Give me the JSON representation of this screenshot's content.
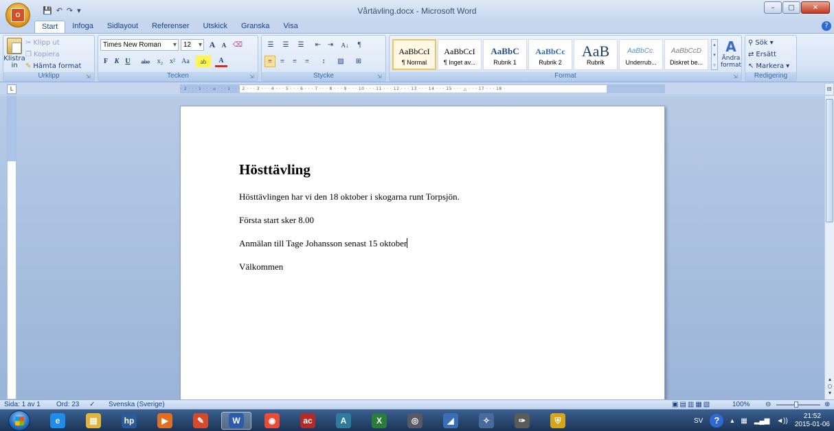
{
  "window": {
    "title": "Vårtävling.docx - Microsoft Word",
    "controls": {
      "minimize": "–",
      "maximize": "□",
      "close": "✕"
    }
  },
  "quick_access": {
    "save": "💾",
    "undo": "↶",
    "redo": "↷",
    "more": "▾"
  },
  "office_logo": "O",
  "tabs": [
    {
      "label": "Start",
      "active": true
    },
    {
      "label": "Infoga"
    },
    {
      "label": "Sidlayout"
    },
    {
      "label": "Referenser"
    },
    {
      "label": "Utskick"
    },
    {
      "label": "Granska"
    },
    {
      "label": "Visa"
    }
  ],
  "help": "?",
  "ribbon": {
    "clipboard": {
      "paste": "Klistra in",
      "cut": "Klipp ut",
      "copy": "Kopiera",
      "format_painter": "Hämta format",
      "group": "Urklipp"
    },
    "font": {
      "family": "Times New Roman",
      "size": "12",
      "grow": "A",
      "shrink": "A",
      "clear": "⌫",
      "bold": "F",
      "italic": "K",
      "underline": "U",
      "strike": "abe",
      "subscript": "x₂",
      "superscript": "x²",
      "case": "Aa",
      "highlight": "ab",
      "color": "A",
      "group": "Tecken"
    },
    "paragraph": {
      "bullets": "☰",
      "numbering": "☰",
      "multilevel": "☰",
      "decrease_indent": "⇤",
      "increase_indent": "⇥",
      "sort": "A↓",
      "pilcrow": "¶",
      "align_left": "≡",
      "center": "≡",
      "align_right": "≡",
      "justify": "≡",
      "line_spacing": "↕",
      "shading": "▨",
      "borders": "⊞",
      "group": "Stycke"
    },
    "styles": {
      "items": [
        {
          "sample": "AaBbCcI",
          "name": "¶ Normal",
          "selected": true
        },
        {
          "sample": "AaBbCcI",
          "name": "¶ Inget av..."
        },
        {
          "sample": "AaBbC",
          "name": "Rubrik 1"
        },
        {
          "sample": "AaBbCc",
          "name": "Rubrik 2"
        },
        {
          "sample": "AaB",
          "name": "Rubrik"
        },
        {
          "sample": "AaBbCc.",
          "name": "Underrub..."
        },
        {
          "sample": "AaBbCcD",
          "name": "Diskret be..."
        }
      ],
      "change_styles": "Ändra format",
      "group": "Format"
    },
    "editing": {
      "find": "Sök",
      "replace": "Ersätt",
      "select": "Markera",
      "group": "Redigering"
    }
  },
  "ruler": {
    "corner": "L",
    "text": "· 2 · · · 1 · · · ⌂ · · · 1 · · · 2 · · · 3 · · · 4 · · · 5 · · · 6 · · · 7 · · · 8 · · · 9 · · · 10 · · · 11 · · · 12 · · · 13 · · · 14 · · · 15 · · · △ · · · 17 · · · 18 ·"
  },
  "document": {
    "heading": "Hösttävling",
    "paragraphs": [
      "Hösttävlingen har vi den 18 oktober i skogarna runt Torpsjön.",
      "Första start sker 8.00",
      "Anmälan till Tage Johansson senast 15 oktober",
      "Välkommen"
    ]
  },
  "statusbar": {
    "page": "Sida: 1 av 1",
    "words": "Ord: 23",
    "language": "Svenska (Sverige)",
    "zoom": "100%"
  },
  "taskbar": {
    "apps": [
      {
        "name": "Internet Explorer",
        "icon": "e",
        "color": "#1f8ee8"
      },
      {
        "name": "Explorer",
        "icon": "▤",
        "color": "#e3b43a"
      },
      {
        "name": "HP",
        "icon": "hp",
        "color": "#2b5a9a"
      },
      {
        "name": "Media",
        "icon": "▶",
        "color": "#e07020"
      },
      {
        "name": "Paint",
        "icon": "✎",
        "color": "#d64a2a"
      },
      {
        "name": "Word",
        "icon": "W",
        "color": "#2b5dab",
        "active": true
      },
      {
        "name": "Chrome",
        "icon": "◉",
        "color": "#e94b35"
      },
      {
        "name": "Access",
        "icon": "ac",
        "color": "#b32a2a"
      },
      {
        "name": "Publisher",
        "icon": "A",
        "color": "#2e7b9e"
      },
      {
        "name": "Excel",
        "icon": "X",
        "color": "#2b7d3b"
      },
      {
        "name": "Remote",
        "icon": "◎",
        "color": "#555a66"
      },
      {
        "name": "Notes",
        "icon": "◢",
        "color": "#3a6fb5"
      },
      {
        "name": "Tools",
        "icon": "✧",
        "color": "#4a6a9a"
      },
      {
        "name": "Mic",
        "icon": "✑",
        "color": "#5a5a5a"
      },
      {
        "name": "Security",
        "icon": "⛨",
        "color": "#d6a51a"
      }
    ],
    "tray": {
      "lang": "SV",
      "help": "?",
      "clock_time": "21:52",
      "clock_date": "2015-01-06"
    }
  }
}
